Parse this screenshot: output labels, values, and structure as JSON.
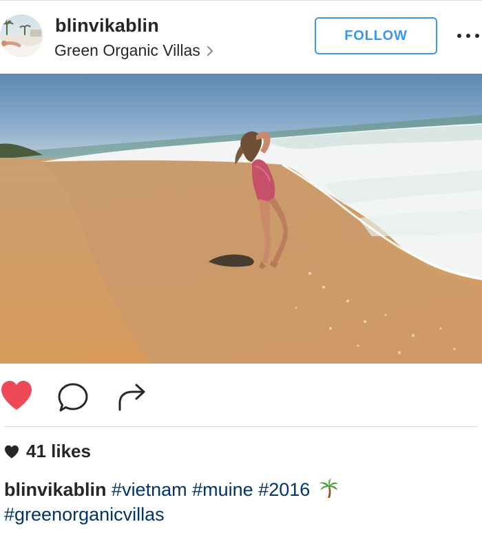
{
  "post": {
    "username": "blinvikablin",
    "location": "Green Organic Villas",
    "follow_label": "FOLLOW",
    "likes_text": "41 likes",
    "caption": {
      "username": "blinvikablin",
      "hashtags": [
        "#vietnam",
        "#muine",
        "#2016",
        "#greenorganicvillas"
      ],
      "emoji": "palm-tree"
    },
    "like_state": "liked",
    "colors": {
      "like_red": "#ed4956",
      "follow_blue": "#3897f0",
      "hashtag_blue": "#003569",
      "text": "#262626",
      "divider": "#dbdbdb"
    },
    "icons": {
      "more": "more-horizontal-icon",
      "like": "heart-filled-icon",
      "comment": "comment-bubble-icon",
      "share": "share-arrow-icon",
      "location_chevron": "chevron-right-icon",
      "likes_heart": "heart-small-icon"
    }
  }
}
